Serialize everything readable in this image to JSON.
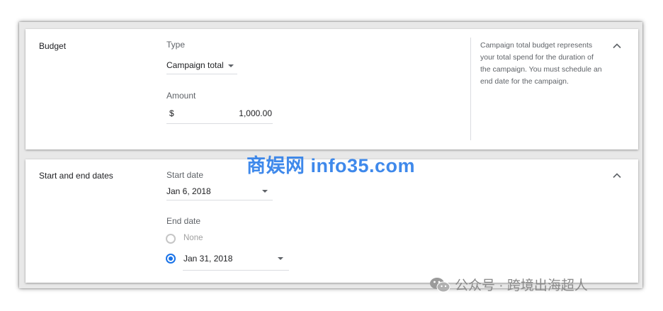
{
  "budget": {
    "title": "Budget",
    "type_label": "Type",
    "type_value": "Campaign total",
    "amount_label": "Amount",
    "currency": "$",
    "amount_value": "1,000.00",
    "help_text": "Campaign total budget represents your total spend for the duration of the campaign. You must schedule an end date for the campaign."
  },
  "dates": {
    "title": "Start and end dates",
    "start_label": "Start date",
    "start_value": "Jan 6, 2018",
    "end_label": "End date",
    "option_none": "None",
    "option_date": "Jan 31, 2018",
    "selected_option": "date"
  },
  "watermarks": {
    "center": "商娱网 info35.com",
    "corner": "公众号 · 跨境出海超人"
  },
  "colors": {
    "accent": "#1a73e8",
    "watermark_blue": "#2b7de9"
  },
  "icons": {
    "collapse": "chevron-up-icon",
    "dropdown": "caret-down-icon",
    "wechat": "wechat-icon"
  }
}
